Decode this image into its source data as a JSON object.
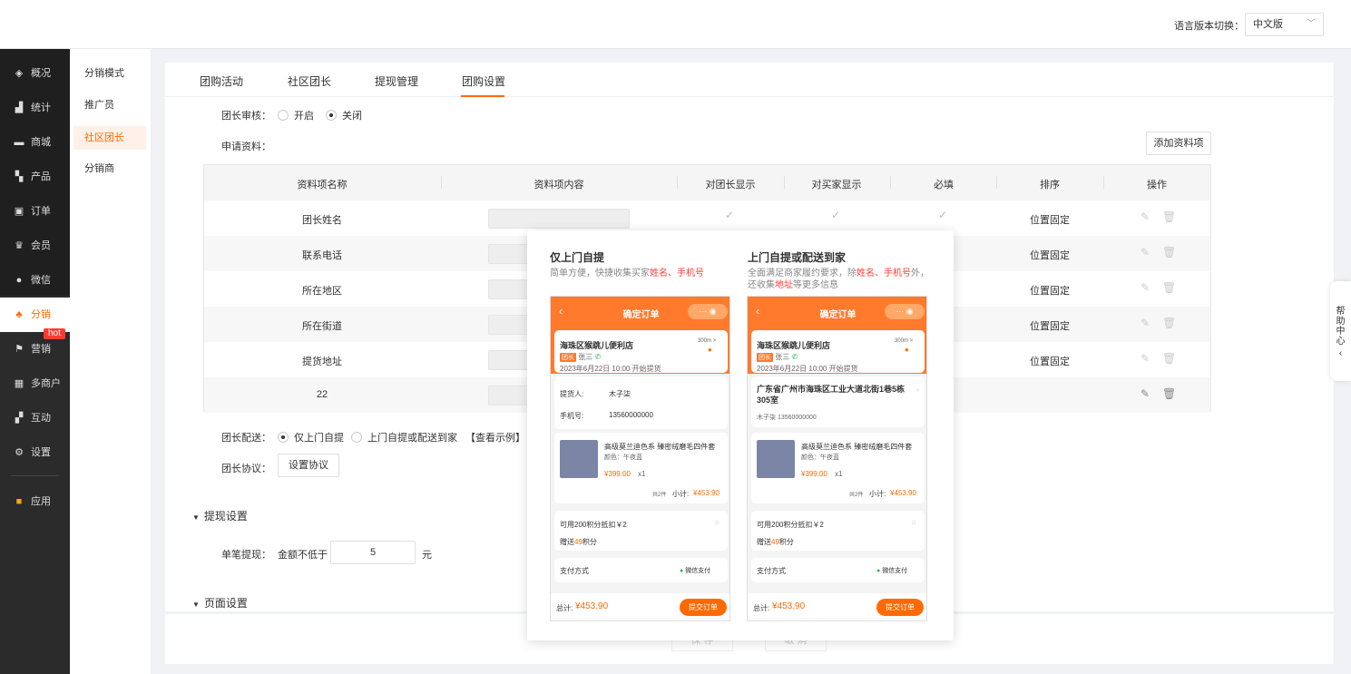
{
  "topbar": {
    "lang_label": "语言版本切换：",
    "lang_value": "中文版"
  },
  "sidebar": {
    "items": [
      {
        "label": "概况",
        "icon": "layers-icon"
      },
      {
        "label": "统计",
        "icon": "chart-icon"
      },
      {
        "label": "商城",
        "icon": "store-icon"
      },
      {
        "label": "产品",
        "icon": "product-icon"
      },
      {
        "label": "订单",
        "icon": "order-icon"
      },
      {
        "label": "会员",
        "icon": "crown-icon"
      },
      {
        "label": "微信",
        "icon": "wechat-icon"
      },
      {
        "label": "分销",
        "icon": "share-icon"
      },
      {
        "label": "营销",
        "icon": "flag-icon"
      },
      {
        "label": "多商户",
        "icon": "merchant-icon"
      },
      {
        "label": "互动",
        "icon": "interact-icon"
      },
      {
        "label": "设置",
        "icon": "gear-icon"
      },
      {
        "label": "应用",
        "icon": "apps-icon"
      }
    ],
    "hot_badge": "hot"
  },
  "submenu": {
    "items": [
      "分销模式",
      "推广员",
      "社区团长",
      "分销商"
    ]
  },
  "tabs": [
    "团购活动",
    "社区团长",
    "提现管理",
    "团购设置"
  ],
  "form": {
    "review_label": "团长审核：",
    "review_on": "开启",
    "review_off": "关闭",
    "apply_label": "申请资料：",
    "add_item_btn": "添加资料项",
    "delivery_label": "团长配送：",
    "delivery_opt1": "仅上门自提",
    "delivery_opt2": "上门自提或配送到家",
    "view_example": "【查看示例】",
    "agreement_label": "团长协议：",
    "agreement_btn": "设置协议",
    "withdraw_section": "提现设置",
    "single_withdraw_label": "单笔提现：",
    "min_amount_label": "金额不低于",
    "min_amount": "5",
    "unit": "元",
    "page_section": "页面设置"
  },
  "table": {
    "headers": [
      "资料项名称",
      "资料项内容",
      "对团长显示",
      "对买家显示",
      "必填",
      "排序",
      "操作"
    ],
    "rows": [
      {
        "name": "团长姓名",
        "sort": "位置固定"
      },
      {
        "name": "联系电话",
        "sort": "位置固定"
      },
      {
        "name": "所在地区",
        "sort": "位置固定"
      },
      {
        "name": "所在街道",
        "sort": "位置固定"
      },
      {
        "name": "提货地址",
        "sort": "位置固定"
      },
      {
        "name": "22",
        "sort": ""
      }
    ]
  },
  "footer": {
    "save": "保 存",
    "cancel": "取 消"
  },
  "help": "帮助中心",
  "popup": {
    "left_title": "仅上门自提",
    "left_desc_a": "简单方便，快捷收集买家",
    "left_desc_red": "姓名、手机号",
    "right_title": "上门自提或配送到家",
    "right_desc_a": "全面满足商家履约要求，除",
    "right_desc_red1": "姓名、手机号",
    "right_desc_b": "外，",
    "right_desc_c": "还收集",
    "right_desc_red2": "地址",
    "right_desc_d": "等更多信息",
    "phone": {
      "title": "确定订单",
      "store": "海珠区猴跳儿便利店",
      "distance": "300m >",
      "tag": "团长",
      "leader": "张三",
      "pickup_time": "2023年6月22日 10:00 开始提货",
      "pickup_person_label": "提货人:",
      "pickup_person": "木子柒",
      "phone_label": "手机号:",
      "phone": "13560000000",
      "address": "广东省广州市海珠区工业大道北街1巷5栋305室",
      "addr_contact": "木子柒   13560000000",
      "product": "高级莫兰迪色系 臻密绒磨毛四件套",
      "spec": "颜色：午夜蓝",
      "price": "¥399.00",
      "qty": "x1",
      "count": "共2件",
      "subtotal_label": "小计:",
      "subtotal": "¥453.90",
      "points": "可用200积分抵扣￥2",
      "gift_a": "赠送",
      "gift_num": "49",
      "gift_b": "积分",
      "pay_label": "支付方式",
      "pay_method": "微信支付",
      "total_label": "总计:",
      "total": "¥453.90",
      "submit": "提交订单"
    }
  }
}
